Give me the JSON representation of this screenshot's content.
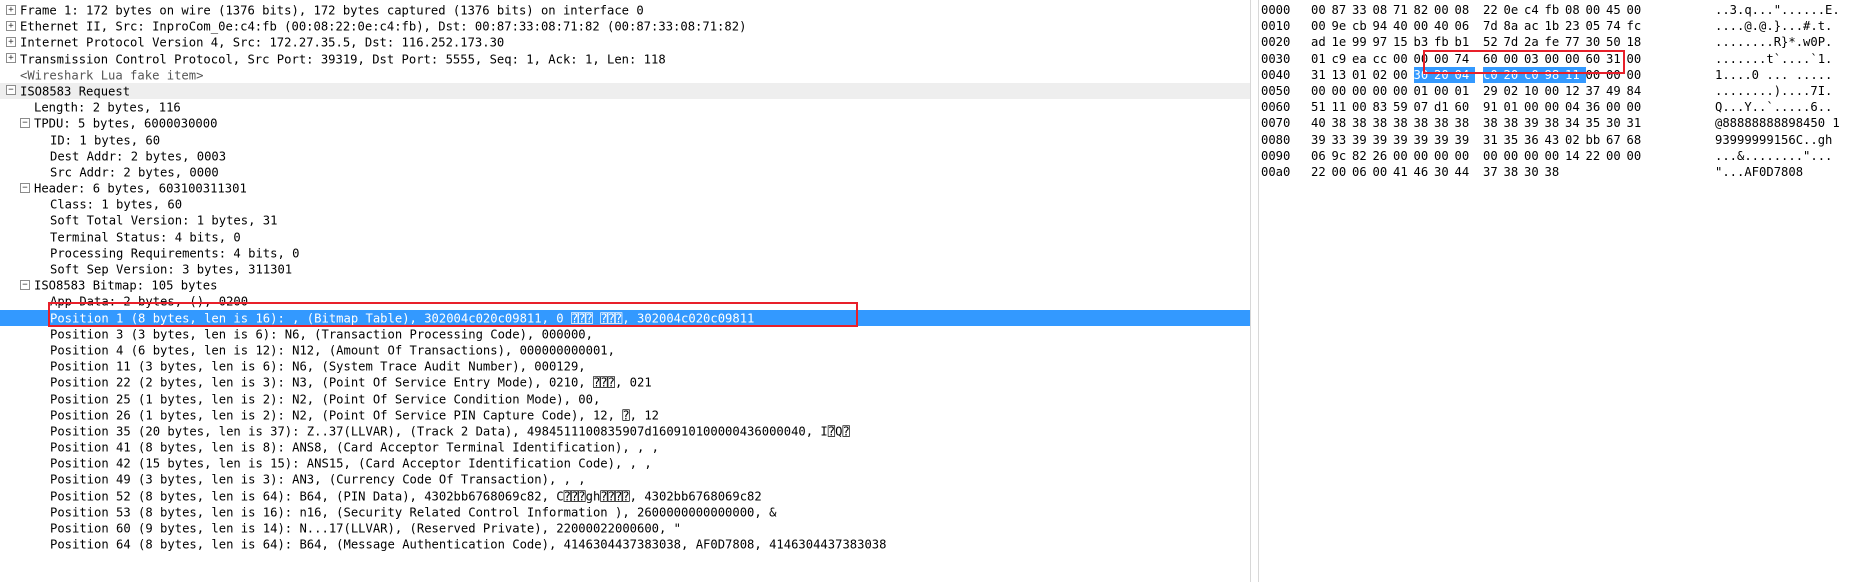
{
  "colors": {
    "selection": "#3399ff",
    "highlight_box": "#e8202a",
    "section_bg": "#eeeeee"
  },
  "details": [
    {
      "text": "Frame 1: 172 bytes on wire (1376 bits), 172 bytes captured (1376 bits) on interface 0",
      "expander": "+",
      "level": 0
    },
    {
      "text": "Ethernet II, Src: InproCom_0e:c4:fb (00:08:22:0e:c4:fb), Dst: 00:87:33:08:71:82 (00:87:33:08:71:82)",
      "expander": "+",
      "level": 0
    },
    {
      "text": "Internet Protocol Version 4, Src: 172.27.35.5, Dst: 116.252.173.30",
      "expander": "+",
      "level": 0
    },
    {
      "text": "Transmission Control Protocol, Src Port: 39319, Dst Port: 5555, Seq: 1, Ack: 1, Len: 118",
      "expander": "+",
      "level": 0
    },
    {
      "text": "<Wireshark Lua fake item>",
      "expander": "",
      "level": 0,
      "fake": true
    },
    {
      "text": "ISO8583 Request",
      "expander": "−",
      "level": 0,
      "section": true
    },
    {
      "text": "Length: 2 bytes, 116",
      "expander": "",
      "level": 1
    },
    {
      "text": "TPDU: 5 bytes, 6000030000",
      "expander": "−",
      "level": 1
    },
    {
      "text": "ID: 1 bytes, 60",
      "expander": "",
      "level": 2
    },
    {
      "text": "Dest Addr: 2 bytes, 0003",
      "expander": "",
      "level": 2
    },
    {
      "text": "Src Addr: 2 bytes, 0000",
      "expander": "",
      "level": 2
    },
    {
      "text": "Header: 6 bytes, 603100311301",
      "expander": "−",
      "level": 1
    },
    {
      "text": "Class: 1 bytes, 60",
      "expander": "",
      "level": 2
    },
    {
      "text": "Soft Total Version: 1 bytes, 31",
      "expander": "",
      "level": 2
    },
    {
      "text": "Terminal Status: 4 bits, 0",
      "expander": "",
      "level": 2
    },
    {
      "text": "Processing Requirements: 4 bits, 0",
      "expander": "",
      "level": 2
    },
    {
      "text": "Soft Sep Version: 3 bytes, 311301",
      "expander": "",
      "level": 2
    },
    {
      "text": "ISO8583 Bitmap: 105 bytes",
      "expander": "−",
      "level": 1
    },
    {
      "text": "App Data: 2 bytes, (), 0200",
      "expander": "",
      "level": 2
    },
    {
      "text": "Position 1 (8 bytes, len is 16): , (Bitmap Table), 302004c020c09811, 0 ⍰⍰⍰ ⍰⍰⍰, 302004c020c09811",
      "expander": "",
      "level": 2,
      "selected": true
    },
    {
      "text": "Position 3 (3 bytes, len is 6): N6, (Transaction Processing Code), 000000,",
      "expander": "",
      "level": 2
    },
    {
      "text": "Position 4 (6 bytes, len is 12): N12, (Amount Of Transactions), 000000000001,",
      "expander": "",
      "level": 2
    },
    {
      "text": "Position 11 (3 bytes, len is 6): N6, (System Trace Audit Number), 000129,",
      "expander": "",
      "level": 2
    },
    {
      "text": "Position 22 (2 bytes, len is 3): N3, (Point Of Service Entry Mode), 0210, ⍰⍰⍰, 021",
      "expander": "",
      "level": 2
    },
    {
      "text": "Position 25 (1 bytes, len is 2): N2, (Point Of Service Condition Mode), 00,",
      "expander": "",
      "level": 2
    },
    {
      "text": "Position 26 (1 bytes, len is 2): N2, (Point Of Service PIN Capture Code), 12, ⍰, 12",
      "expander": "",
      "level": 2
    },
    {
      "text": "Position 35 (20 bytes, len is 37): Z..37(LLVAR), (Track 2 Data), 4984511100835907d160910100000436000040, I⍰Q⍰",
      "expander": "",
      "level": 2
    },
    {
      "text": "Position 41 (8 bytes, len is 8): ANS8, (Card Acceptor Terminal Identification), , ,",
      "expander": "",
      "level": 2
    },
    {
      "text": "Position 42 (15 bytes, len is 15): ANS15, (Card Acceptor Identification Code), , ,",
      "expander": "",
      "level": 2
    },
    {
      "text": "Position 49 (3 bytes, len is 3): AN3, (Currency Code Of Transaction), , ,",
      "expander": "",
      "level": 2
    },
    {
      "text": "Position 52 (8 bytes, len is 64): B64, (PIN Data), 4302bb6768069c82, C⍰⍰⍰gh⍰⍰⍰⍰, 4302bb6768069c82",
      "expander": "",
      "level": 2
    },
    {
      "text": "Position 53 (8 bytes, len is 16): n16, (Security Related Control Information ), 2600000000000000, &",
      "expander": "",
      "level": 2
    },
    {
      "text": "Position 60 (9 bytes, len is 14): N...17(LLVAR), (Reserved Private), 22000022000600, \"",
      "expander": "",
      "level": 2
    },
    {
      "text": "Position 64 (8 bytes, len is 64): B64, (Message Authentication Code), 4146304437383038, AF0D7808, 4146304437383038",
      "expander": "",
      "level": 2
    }
  ],
  "hex": [
    {
      "offset": "0000",
      "bytes": [
        "00",
        "87",
        "33",
        "08",
        "71",
        "82",
        "00",
        "08",
        "22",
        "0e",
        "c4",
        "fb",
        "08",
        "00",
        "45",
        "00"
      ],
      "ascii": "..3.q...\"......E."
    },
    {
      "offset": "0010",
      "bytes": [
        "00",
        "9e",
        "cb",
        "94",
        "40",
        "00",
        "40",
        "06",
        "7d",
        "8a",
        "ac",
        "1b",
        "23",
        "05",
        "74",
        "fc"
      ],
      "ascii": "....@.@.}...#.t."
    },
    {
      "offset": "0020",
      "bytes": [
        "ad",
        "1e",
        "99",
        "97",
        "15",
        "b3",
        "fb",
        "b1",
        "52",
        "7d",
        "2a",
        "fe",
        "77",
        "30",
        "50",
        "18"
      ],
      "ascii": "........R}*.w0P."
    },
    {
      "offset": "0030",
      "bytes": [
        "01",
        "c9",
        "ea",
        "cc",
        "00",
        "00",
        "00",
        "74",
        "60",
        "00",
        "03",
        "00",
        "00",
        "60",
        "31",
        "00"
      ],
      "ascii": ".......t`....`1."
    },
    {
      "offset": "0040",
      "bytes": [
        "31",
        "13",
        "01",
        "02",
        "00",
        "30",
        "20",
        "04",
        "c0",
        "20",
        "c0",
        "98",
        "11",
        "00",
        "00",
        "00"
      ],
      "ascii": "1....0 ... .....",
      "sel": [
        5,
        12
      ]
    },
    {
      "offset": "0050",
      "bytes": [
        "00",
        "00",
        "00",
        "00",
        "00",
        "01",
        "00",
        "01",
        "29",
        "02",
        "10",
        "00",
        "12",
        "37",
        "49",
        "84"
      ],
      "ascii": "........)....7I."
    },
    {
      "offset": "0060",
      "bytes": [
        "51",
        "11",
        "00",
        "83",
        "59",
        "07",
        "d1",
        "60",
        "91",
        "01",
        "00",
        "00",
        "04",
        "36",
        "00",
        "00"
      ],
      "ascii": "Q...Y..`.....6.."
    },
    {
      "offset": "0070",
      "bytes": [
        "40",
        "38",
        "38",
        "38",
        "38",
        "38",
        "38",
        "38",
        "38",
        "38",
        "39",
        "38",
        "34",
        "35",
        "30",
        "31"
      ],
      "ascii": "@88888888898450 1"
    },
    {
      "offset": "0080",
      "bytes": [
        "39",
        "33",
        "39",
        "39",
        "39",
        "39",
        "39",
        "39",
        "31",
        "35",
        "36",
        "43",
        "02",
        "bb",
        "67",
        "68"
      ],
      "ascii": "93999999156C..gh"
    },
    {
      "offset": "0090",
      "bytes": [
        "06",
        "9c",
        "82",
        "26",
        "00",
        "00",
        "00",
        "00",
        "00",
        "00",
        "00",
        "00",
        "14",
        "22",
        "00",
        "00"
      ],
      "ascii": "...&........\"..."
    },
    {
      "offset": "00a0",
      "bytes": [
        "22",
        "00",
        "06",
        "00",
        "41",
        "46",
        "30",
        "44",
        "37",
        "38",
        "30",
        "38"
      ],
      "ascii": "\"...AF0D7808"
    }
  ]
}
